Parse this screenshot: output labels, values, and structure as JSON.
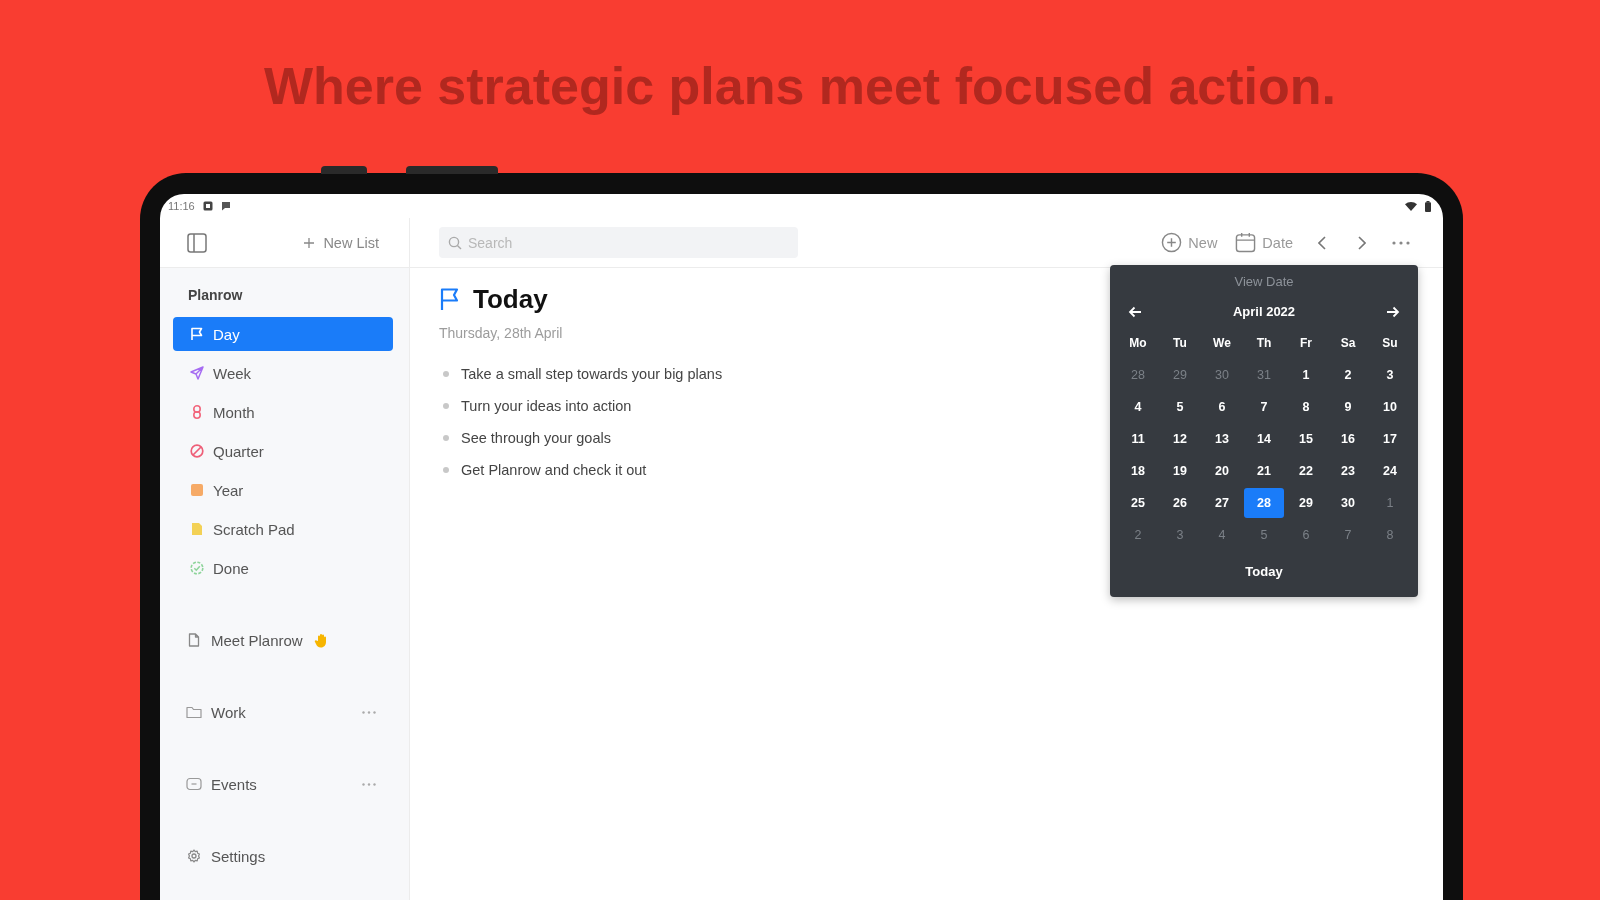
{
  "headline": "Where strategic plans meet focused action.",
  "status_bar": {
    "time": "11:16"
  },
  "sidebar": {
    "new_list_button": "New List",
    "section_title": "Planrow",
    "items": [
      {
        "label": "Day",
        "selected": true,
        "color": "#ffffff"
      },
      {
        "label": "Week",
        "selected": false,
        "color": "#a66cf2"
      },
      {
        "label": "Month",
        "selected": false,
        "color": "#f2667c"
      },
      {
        "label": "Quarter",
        "selected": false,
        "color": "#ee5f78"
      },
      {
        "label": "Year",
        "selected": false,
        "color": "#f6aa66"
      },
      {
        "label": "Scratch Pad",
        "selected": false,
        "color": "#f3d155"
      },
      {
        "label": "Done",
        "selected": false,
        "color": "#8ed49a"
      }
    ],
    "pages": [
      {
        "label": "Meet Planrow"
      }
    ],
    "folders": [
      {
        "label": "Work"
      },
      {
        "label": "Events"
      }
    ],
    "settings": "Settings"
  },
  "toolbar": {
    "search": {
      "placeholder": "Search"
    },
    "new_button": "New",
    "date_button": "Date"
  },
  "content": {
    "title": "Today",
    "date": "Thursday, 28th April",
    "bullets": [
      "Take a small step towards your big plans",
      "Turn your ideas into action",
      "See through your goals",
      "Get Planrow and check it out"
    ]
  },
  "date_picker": {
    "title": "View Date",
    "month": "April 2022",
    "weekdays": [
      "Mo",
      "Tu",
      "We",
      "Th",
      "Fr",
      "Sa",
      "Su"
    ],
    "weeks": [
      [
        {
          "label": "28",
          "muted": true,
          "selected": false
        },
        {
          "label": "29",
          "muted": true,
          "selected": false
        },
        {
          "label": "30",
          "muted": true,
          "selected": false
        },
        {
          "label": "31",
          "muted": true,
          "selected": false
        },
        {
          "label": "1",
          "muted": false,
          "selected": false
        },
        {
          "label": "2",
          "muted": false,
          "selected": false
        },
        {
          "label": "3",
          "muted": false,
          "selected": false
        }
      ],
      [
        {
          "label": "4",
          "muted": false,
          "selected": false
        },
        {
          "label": "5",
          "muted": false,
          "selected": false
        },
        {
          "label": "6",
          "muted": false,
          "selected": false
        },
        {
          "label": "7",
          "muted": false,
          "selected": false
        },
        {
          "label": "8",
          "muted": false,
          "selected": false
        },
        {
          "label": "9",
          "muted": false,
          "selected": false
        },
        {
          "label": "10",
          "muted": false,
          "selected": false
        }
      ],
      [
        {
          "label": "11",
          "muted": false,
          "selected": false
        },
        {
          "label": "12",
          "muted": false,
          "selected": false
        },
        {
          "label": "13",
          "muted": false,
          "selected": false
        },
        {
          "label": "14",
          "muted": false,
          "selected": false
        },
        {
          "label": "15",
          "muted": false,
          "selected": false
        },
        {
          "label": "16",
          "muted": false,
          "selected": false
        },
        {
          "label": "17",
          "muted": false,
          "selected": false
        }
      ],
      [
        {
          "label": "18",
          "muted": false,
          "selected": false
        },
        {
          "label": "19",
          "muted": false,
          "selected": false
        },
        {
          "label": "20",
          "muted": false,
          "selected": false
        },
        {
          "label": "21",
          "muted": false,
          "selected": false
        },
        {
          "label": "22",
          "muted": false,
          "selected": false
        },
        {
          "label": "23",
          "muted": false,
          "selected": false
        },
        {
          "label": "24",
          "muted": false,
          "selected": false
        }
      ],
      [
        {
          "label": "25",
          "muted": false,
          "selected": false
        },
        {
          "label": "26",
          "muted": false,
          "selected": false
        },
        {
          "label": "27",
          "muted": false,
          "selected": false
        },
        {
          "label": "28",
          "muted": false,
          "selected": true
        },
        {
          "label": "29",
          "muted": false,
          "selected": false
        },
        {
          "label": "30",
          "muted": false,
          "selected": false
        },
        {
          "label": "1",
          "muted": true,
          "selected": false
        }
      ],
      [
        {
          "label": "2",
          "muted": true,
          "selected": false
        },
        {
          "label": "3",
          "muted": true,
          "selected": false
        },
        {
          "label": "4",
          "muted": true,
          "selected": false
        },
        {
          "label": "5",
          "muted": true,
          "selected": false
        },
        {
          "label": "6",
          "muted": true,
          "selected": false
        },
        {
          "label": "7",
          "muted": true,
          "selected": false
        },
        {
          "label": "8",
          "muted": true,
          "selected": false
        }
      ]
    ],
    "today_button": "Today"
  }
}
